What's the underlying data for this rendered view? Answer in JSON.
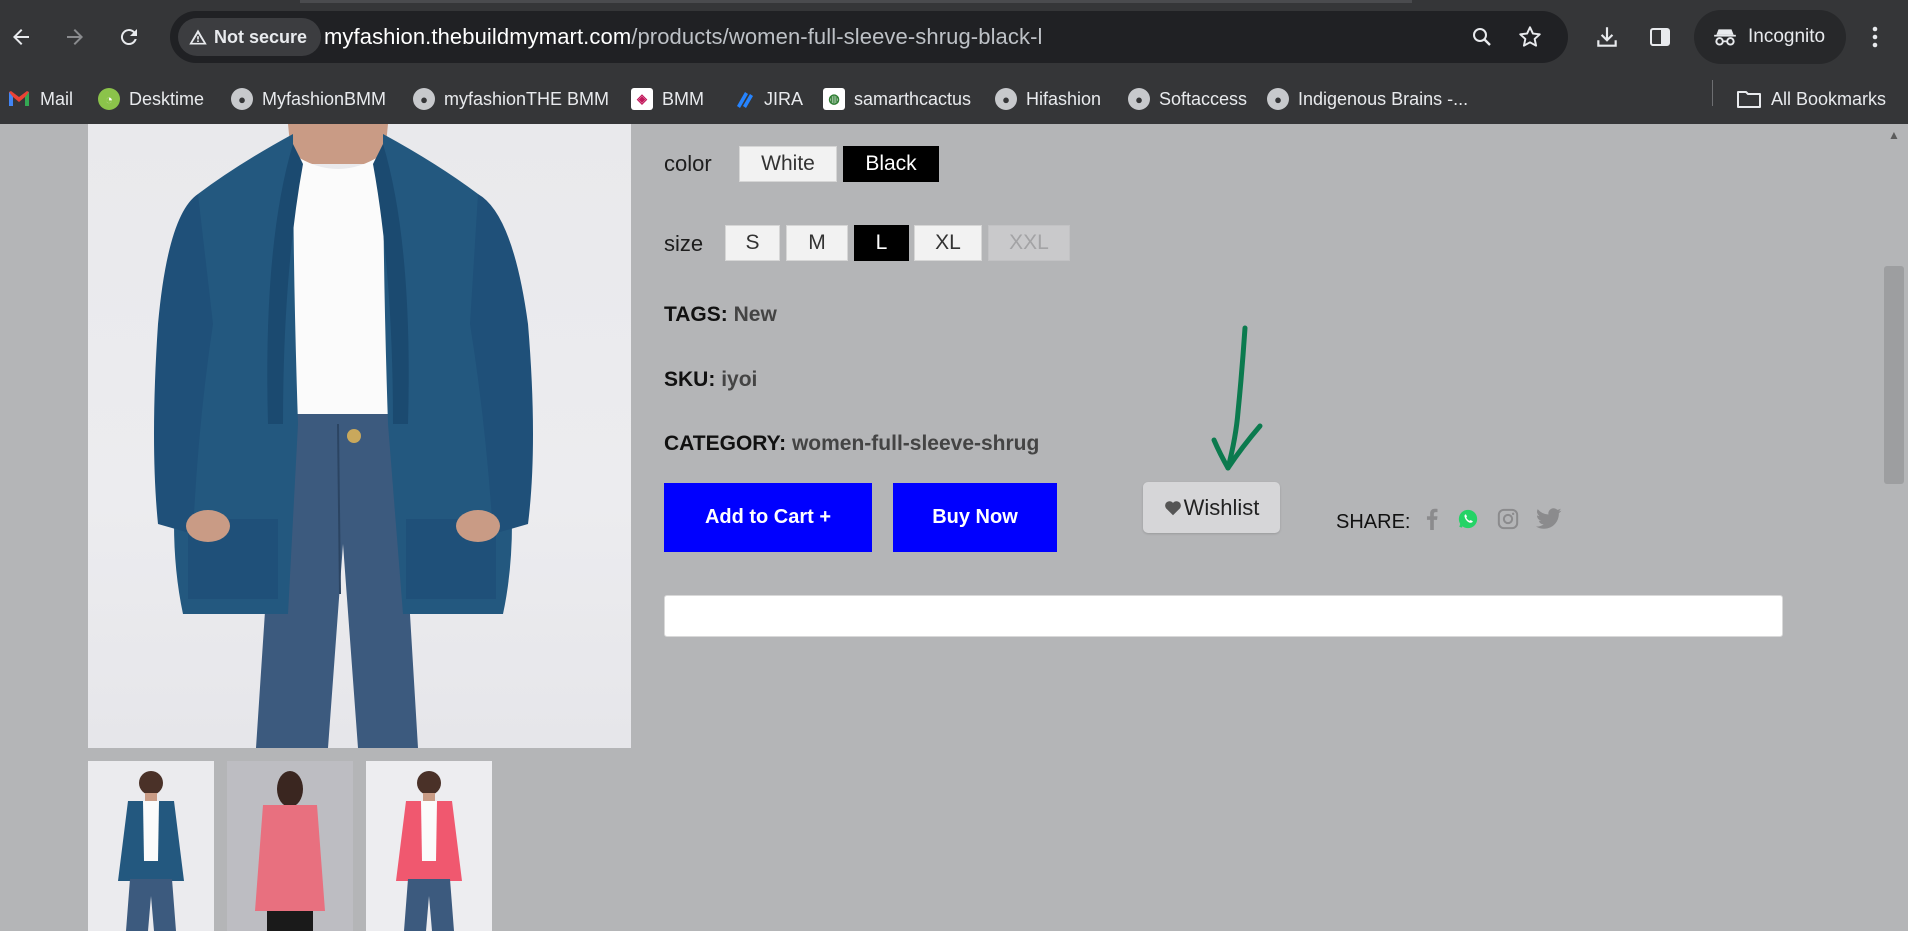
{
  "browser": {
    "security_label": "Not secure",
    "url_host": "myfashion.thebuildmymart.com",
    "url_path": "/products/women-full-sleeve-shrug-black-l",
    "profile_label": "Incognito"
  },
  "bookmarks": [
    {
      "label": "Mail",
      "icon": "gmail-icon"
    },
    {
      "label": "Desktime",
      "icon": "desktime-icon"
    },
    {
      "label": "MyfashionBMM",
      "icon": "globe-icon"
    },
    {
      "label": "myfashionTHE BMM",
      "icon": "globe-icon"
    },
    {
      "label": "BMM",
      "icon": "bmm-icon"
    },
    {
      "label": "JIRA",
      "icon": "jira-icon"
    },
    {
      "label": "samarthcactus",
      "icon": "cactus-icon"
    },
    {
      "label": "Hifashion",
      "icon": "globe-icon"
    },
    {
      "label": "Softaccess",
      "icon": "globe-icon"
    },
    {
      "label": "Indigenous Brains -...",
      "icon": "globe-icon"
    }
  ],
  "all_bookmarks_label": "All Bookmarks",
  "product": {
    "color_label": "color",
    "colors": [
      {
        "label": "White",
        "selected": false
      },
      {
        "label": "Black",
        "selected": true
      }
    ],
    "size_label": "size",
    "sizes": [
      {
        "label": "S",
        "state": "available"
      },
      {
        "label": "M",
        "state": "available"
      },
      {
        "label": "L",
        "state": "selected"
      },
      {
        "label": "XL",
        "state": "available"
      },
      {
        "label": "XXL",
        "state": "disabled"
      }
    ],
    "tags_label": "TAGS:",
    "tags_value": "New",
    "sku_label": "SKU:",
    "sku_value": "iyoi",
    "category_label": "CATEGORY:",
    "category_value": "women-full-sleeve-shrug",
    "add_to_cart_label": "Add to Cart +",
    "buy_now_label": "Buy Now",
    "wishlist_label": "Wishlist",
    "share_label": "SHARE:",
    "share_icons": [
      "facebook-icon",
      "whatsapp-icon",
      "instagram-icon",
      "twitter-icon"
    ]
  },
  "colors": {
    "accent_blue": "#0000ff",
    "annotation_arrow": "#0b7a4e",
    "whatsapp": "#25d366"
  }
}
